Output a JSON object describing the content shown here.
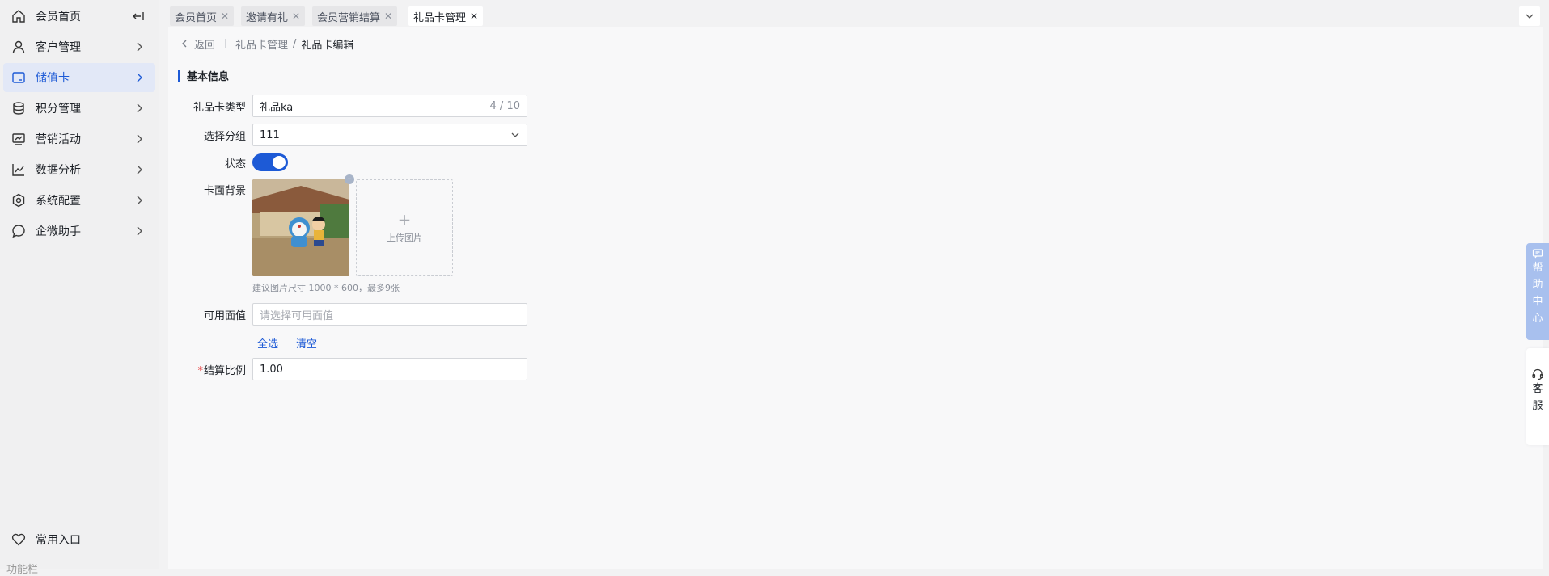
{
  "sidebar": {
    "items": [
      {
        "label": "会员首页",
        "icon": "home-icon"
      },
      {
        "label": "客户管理",
        "icon": "user-icon"
      },
      {
        "label": "储值卡",
        "icon": "card-icon",
        "active": true
      },
      {
        "label": "积分管理",
        "icon": "database-icon"
      },
      {
        "label": "营销活动",
        "icon": "monitor-chart-icon"
      },
      {
        "label": "数据分析",
        "icon": "line-chart-icon"
      },
      {
        "label": "系统配置",
        "icon": "gear-icon"
      },
      {
        "label": "企微助手",
        "icon": "chat-bubble-icon"
      }
    ],
    "favorites_label": "常用入口",
    "cut_label": "功能栏"
  },
  "tabs": [
    {
      "label": "会员首页",
      "active": false
    },
    {
      "label": "邀请有礼",
      "active": false
    },
    {
      "label": "会员营销结算",
      "active": false
    },
    {
      "label": "礼品卡管理",
      "active": true
    }
  ],
  "header": {
    "back_label": "返回",
    "breadcrumb_parent": "礼品卡管理",
    "breadcrumb_sep": "/",
    "breadcrumb_current": "礼品卡编辑"
  },
  "form": {
    "section_title": "基本信息",
    "card_type": {
      "label": "礼品卡类型",
      "value": "礼品ka",
      "counter": "4 / 10"
    },
    "group": {
      "label": "选择分组",
      "value": "111"
    },
    "status": {
      "label": "状态",
      "on": true
    },
    "background": {
      "label": "卡面背景",
      "upload_label": "上传图片",
      "hint": "建议图片尺寸 1000 * 600，最多9张"
    },
    "face_value": {
      "label": "可用面值",
      "placeholder": "请选择可用面值"
    },
    "select_all": "全选",
    "clear": "清空",
    "ratio": {
      "label": "结算比例",
      "required_mark": "*",
      "value": "1.00"
    }
  },
  "float": {
    "help_chars": [
      "帮",
      "助",
      "中",
      "心"
    ],
    "service_chars": [
      "客",
      "服"
    ]
  },
  "colors": {
    "accent": "#1d5ad6",
    "active_bg": "#e2e8f7",
    "required": "#e84b4b"
  }
}
